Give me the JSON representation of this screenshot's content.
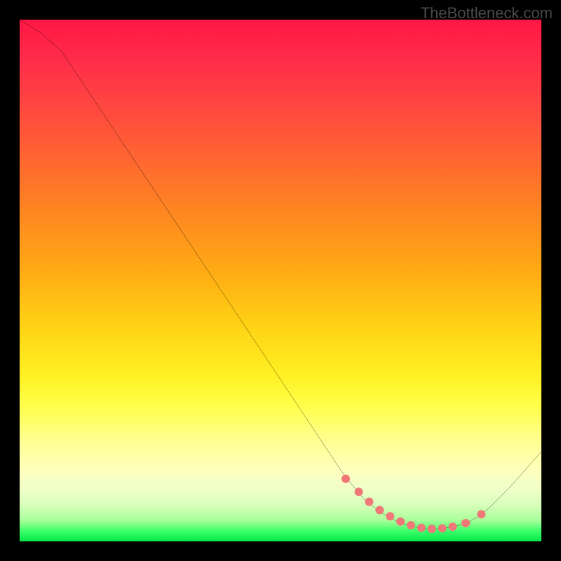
{
  "watermark": "TheBottleneck.com",
  "chart_data": {
    "type": "line",
    "title": "",
    "xlabel": "",
    "ylabel": "",
    "xlim": [
      0,
      100
    ],
    "ylim": [
      0,
      100
    ],
    "series": [
      {
        "name": "curve",
        "x": [
          0,
          4,
          8,
          12,
          16,
          20,
          24,
          28,
          32,
          36,
          40,
          44,
          48,
          52,
          56,
          60,
          62,
          64,
          66,
          68,
          70,
          72,
          74,
          76,
          78,
          80,
          82,
          84,
          86,
          88,
          90,
          94,
          100
        ],
        "y": [
          100,
          97.5,
          94,
          88,
          82,
          76,
          70,
          64,
          58,
          52,
          46,
          40,
          34,
          28,
          22,
          16,
          13,
          10.5,
          8.1,
          6.5,
          5.1,
          4.0,
          3.2,
          2.7,
          2.4,
          2.4,
          2.6,
          3.0,
          3.7,
          4.8,
          6.4,
          10.4,
          17.2
        ]
      }
    ],
    "markers": {
      "x": [
        62.5,
        65,
        67,
        69,
        71,
        73,
        75,
        77,
        79,
        81,
        83,
        85.5,
        88.5
      ],
      "y": [
        12.0,
        9.5,
        7.6,
        6.0,
        4.8,
        3.8,
        3.1,
        2.6,
        2.4,
        2.5,
        2.8,
        3.5,
        5.2
      ],
      "color": "#f07878",
      "radius": 6
    },
    "gradient_stops": [
      {
        "pos": 0.0,
        "color": "#ff1744"
      },
      {
        "pos": 0.5,
        "color": "#ffcc14"
      },
      {
        "pos": 0.8,
        "color": "#ffff70"
      },
      {
        "pos": 1.0,
        "color": "#05e84a"
      }
    ]
  }
}
